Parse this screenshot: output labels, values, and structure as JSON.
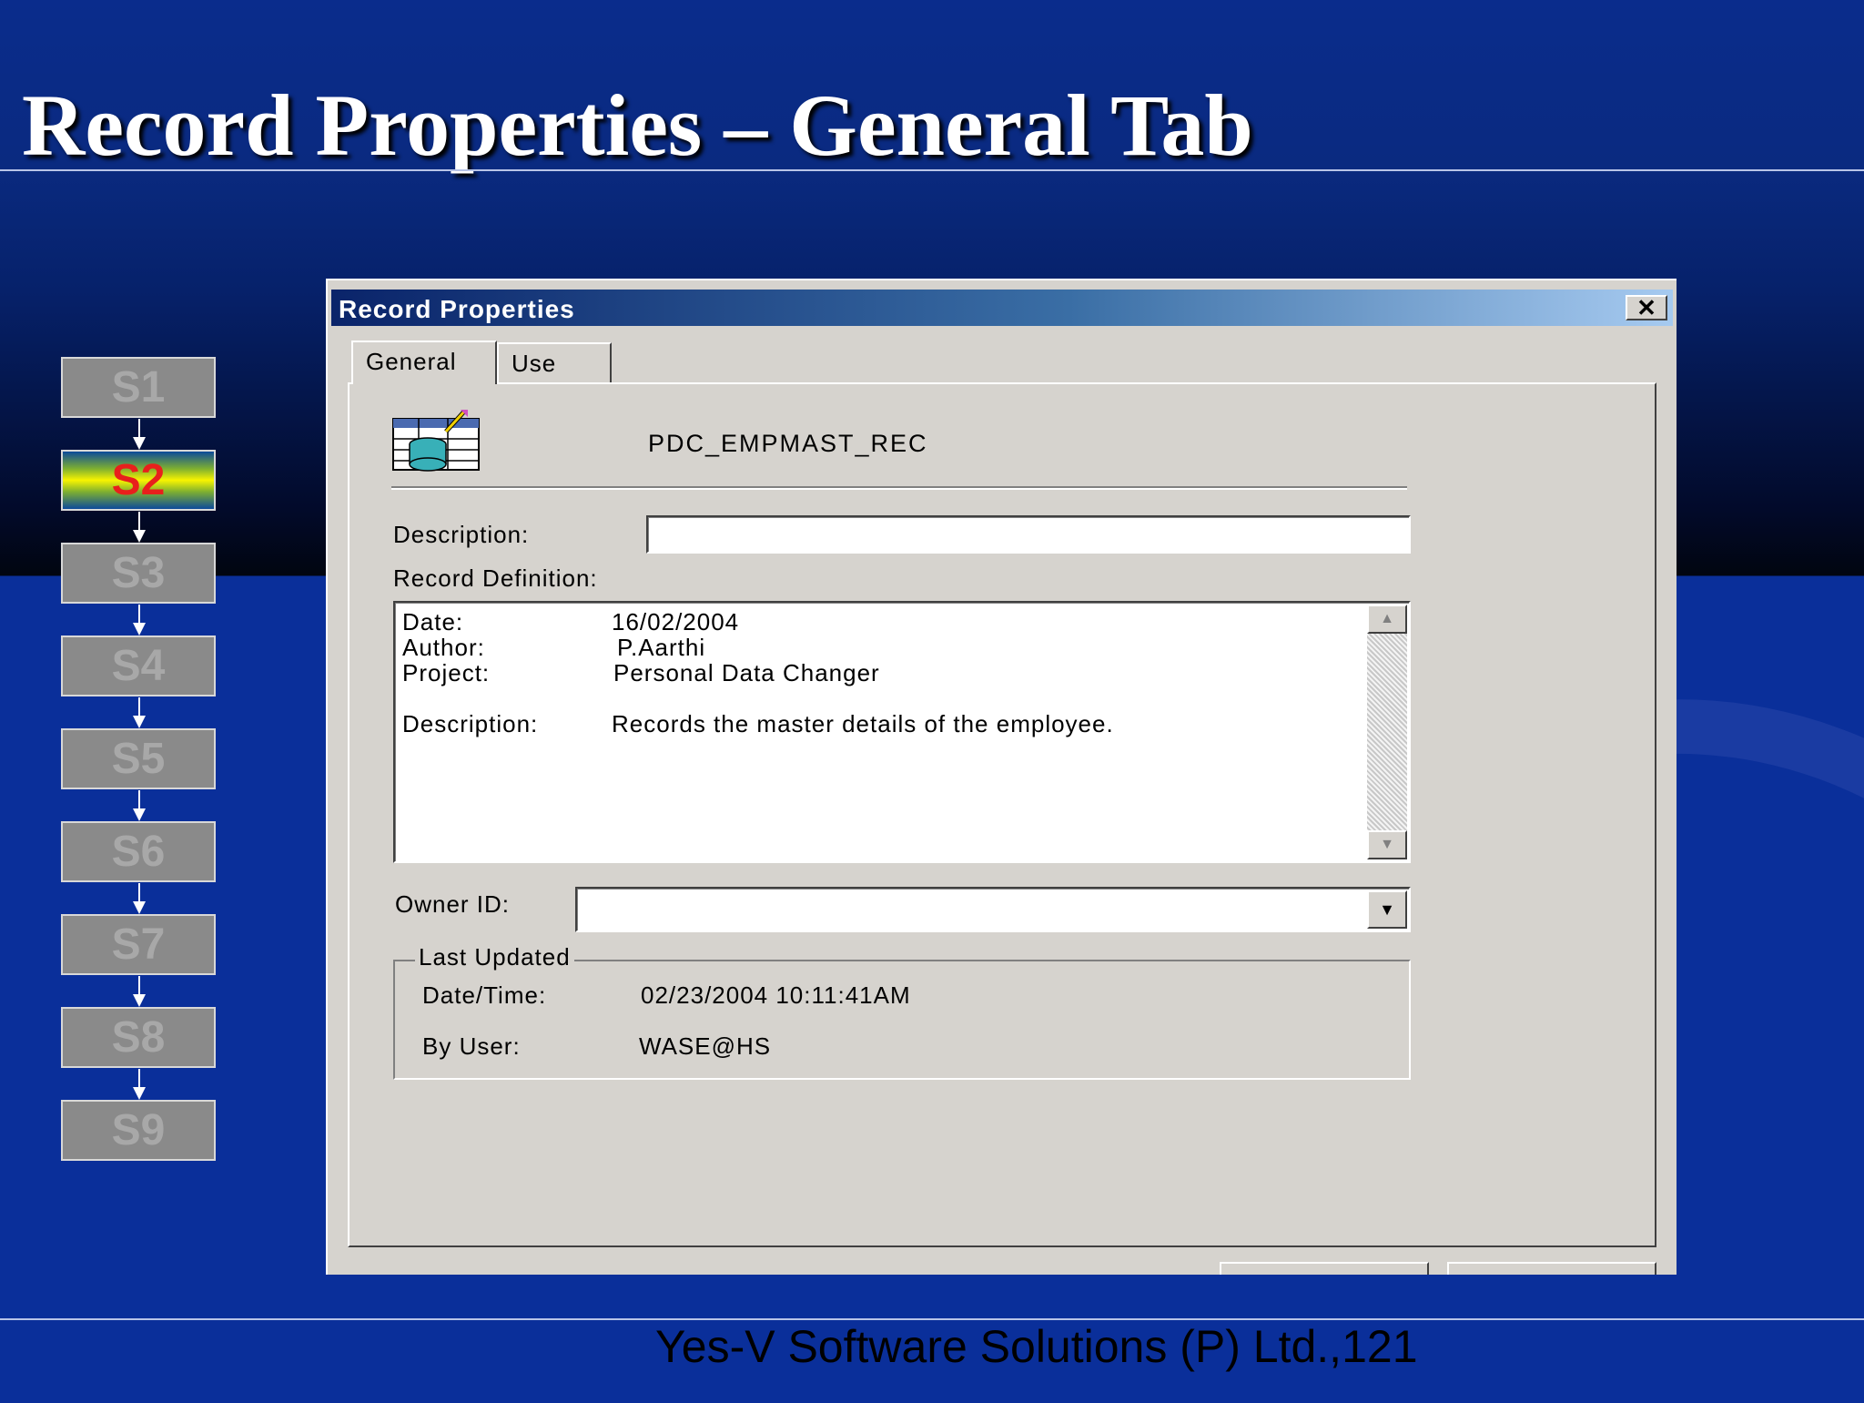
{
  "slide": {
    "title": "Record Properties – General Tab",
    "footer": "Yes-V Software Solutions (P) Ltd.,121"
  },
  "steps": [
    "S1",
    "S2",
    "S3",
    "S4",
    "S5",
    "S6",
    "S7",
    "S8",
    "S9"
  ],
  "active_step": "S2",
  "dialog": {
    "title": "Record Properties",
    "close_icon": "close-icon",
    "tabs": [
      "General",
      "Use"
    ],
    "active_tab": "General",
    "record_name": "PDC_EMPMAST_REC",
    "description_label": "Description:",
    "description_value": "",
    "record_definition_label": "Record Definition:",
    "record_definition": [
      {
        "key": "Date:",
        "value": "16/02/2004"
      },
      {
        "key": "Author:",
        "value": "P.Aarthi"
      },
      {
        "key": "Project:",
        "value": "Personal Data Changer"
      },
      {
        "key": "Description:",
        "value": "Records the master details of the employee."
      }
    ],
    "owner_id_label": "Owner ID:",
    "owner_id_value": "",
    "last_updated": {
      "legend": "Last Updated",
      "date_time_label": "Date/Time:",
      "date_time_value": "02/23/2004 10:11:41AM",
      "by_user_label": "By User:",
      "by_user_value": "WASE@HS"
    }
  },
  "colors": {
    "slide_blue": "#0a2f9a",
    "dialog_face": "#d6d3ce",
    "titlebar_start": "#0a246a",
    "titlebar_end": "#a6caf0",
    "step_active_text": "#e8201c"
  }
}
